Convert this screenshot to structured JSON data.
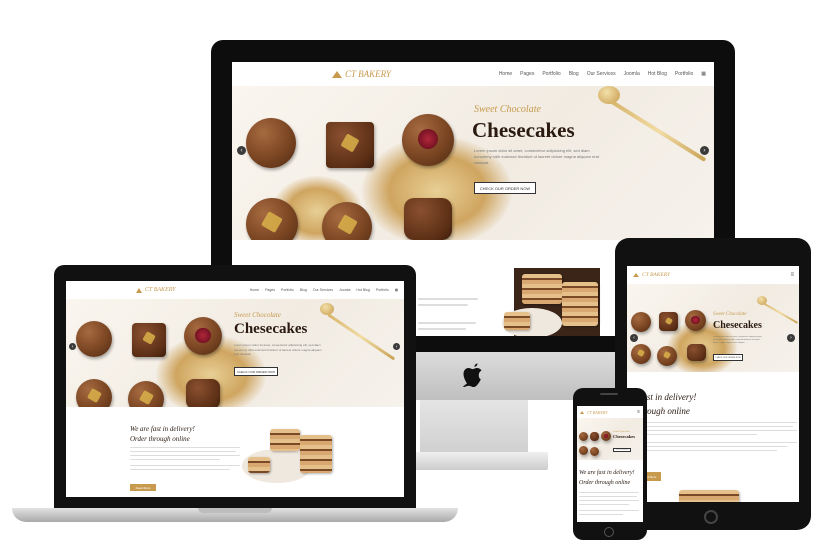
{
  "brand": {
    "logo_text": "CT BAKERY",
    "accent": "#c79a4e",
    "dark": "#2a1a10"
  },
  "nav": {
    "items": [
      "Home",
      "Pages",
      "Portfolio",
      "Blog",
      "Our Services",
      "Joomla",
      "Hot Blog",
      "Portfolio"
    ],
    "icon": "grid-icon",
    "mobile_icon": "hamburger-icon"
  },
  "hero": {
    "subtitle": "Sweet Chocolate",
    "title": "Chesecakes",
    "text": "Lorem ipsum dolor sit amet, consectetur adipisicing elit, sed diam nonummy nibh euismod tincidunt ut laoreet dolore magna aliquam erat volutpat.",
    "button": "CHECK OUR ORDER NOW",
    "prev_icon": "chevron-left-icon",
    "next_icon": "chevron-right-icon"
  },
  "section": {
    "heading1": "We are fast in delivery!",
    "heading2": "Order through online",
    "button": "Read More"
  },
  "devices": {
    "desktop_logo_icon": "apple-icon"
  }
}
